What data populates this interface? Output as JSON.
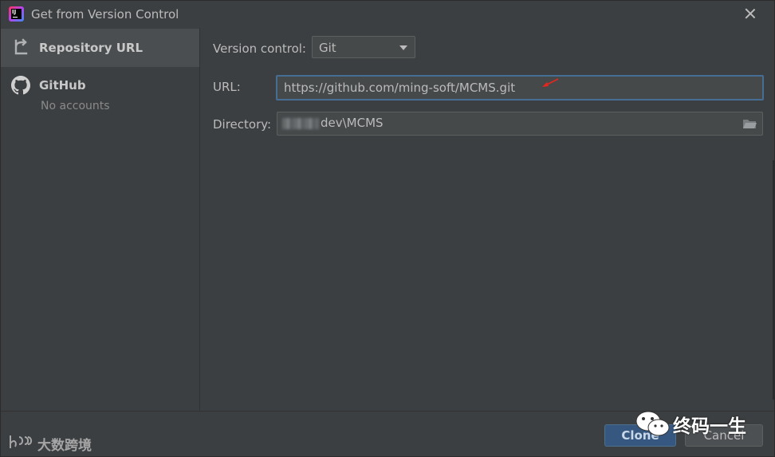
{
  "window": {
    "title": "Get from Version Control"
  },
  "sidebar": {
    "items": [
      {
        "label": "Repository URL",
        "icon": "repository-icon",
        "selected": true
      },
      {
        "label": "GitHub",
        "sublabel": "No accounts",
        "icon": "github-icon",
        "selected": false
      }
    ]
  },
  "form": {
    "version_control_label": "Version control:",
    "version_control_value": "Git",
    "url_label": "URL:",
    "url_value": "https://github.com/ming-soft/MCMS.git",
    "directory_label": "Directory:",
    "directory_value": "dev\\MCMS"
  },
  "buttons": {
    "clone": "Clone",
    "cancel": "Cancel"
  },
  "watermarks": {
    "left": "大数跨境",
    "right": "终码一生"
  },
  "colors": {
    "background": "#3c3f41",
    "selected": "#4b4e50",
    "focus_border": "#466d94",
    "primary_button": "#365880",
    "annotation_arrow": "#e8261e"
  }
}
